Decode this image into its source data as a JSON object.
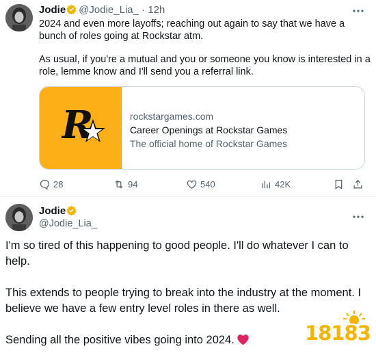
{
  "tweet1": {
    "author_name": "Jodie",
    "handle": "@Jodie_Lia_",
    "separator": "·",
    "time": "12h",
    "paragraphs": [
      "2024 and even more layoffs; reaching out again to say that we have a bunch of roles going at Rockstar atm.",
      "As usual, if you're a mutual and you or someone you know is interested in a role, lemme know and I'll send you a referral link."
    ],
    "card": {
      "domain": "rockstargames.com",
      "title": "Career Openings at Rockstar Games",
      "description": "The official home of Rockstar Games",
      "logo_letter": "R",
      "logo_color": "#fcaf17"
    },
    "actions": {
      "replies": "28",
      "reposts": "94",
      "likes": "540",
      "views": "42K"
    },
    "icons": [
      "more-icon",
      "reply-icon",
      "repost-icon",
      "like-icon",
      "views-icon",
      "bookmark-icon",
      "share-icon"
    ]
  },
  "tweet2": {
    "author_name": "Jodie",
    "handle": "@Jodie_Lia_",
    "paragraphs": [
      "I'm so tired of this happening to good people. I'll do whatever I can to help.",
      "This extends to people trying to break into the industry at the moment. I believe we have a few entry level roles in there as well.",
      "Sending all the positive vibes going into 2024."
    ],
    "emoji": "red-heart-icon"
  },
  "watermark": {
    "text": "18183"
  },
  "colors": {
    "text": "#0f1419",
    "secondary": "#536471",
    "border": "#cfd9de",
    "verified_badge": "#f4b400",
    "heart": "#e0245e"
  }
}
